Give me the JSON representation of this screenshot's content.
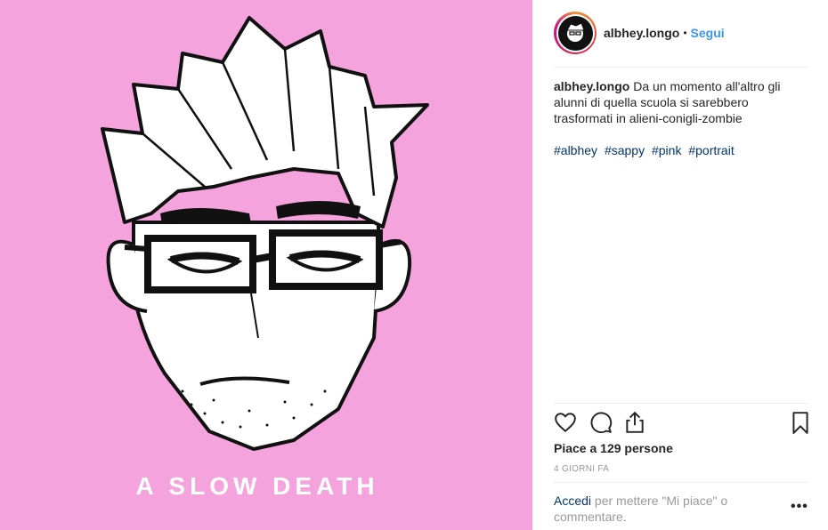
{
  "post": {
    "artwork_title": "A SLOW DEATH",
    "background_color": "#f5a3dc"
  },
  "header": {
    "username": "albhey.longo",
    "separator": "•",
    "follow_label": "Segui"
  },
  "caption": {
    "username": "albhey.longo",
    "text": "Da un momento all'altro gli alunni di quella scuola si sarebbero trasformati in alieni-conigli-zombie",
    "hashtags": [
      "#albhey",
      "#sappy",
      "#pink",
      "#portrait"
    ]
  },
  "actions": {
    "icons": [
      "heart-icon",
      "comment-icon",
      "share-icon",
      "bookmark-icon"
    ]
  },
  "likes_text": "Piace a 129 persone",
  "timestamp": "4 GIORNI FA",
  "login_prompt": {
    "link": "Accedi",
    "text": " per mettere \"Mi piace\" o commentare."
  },
  "more_label": "•••",
  "colors": {
    "link_blue": "#3897f0",
    "hashtag": "#003569",
    "muted": "#999999"
  }
}
